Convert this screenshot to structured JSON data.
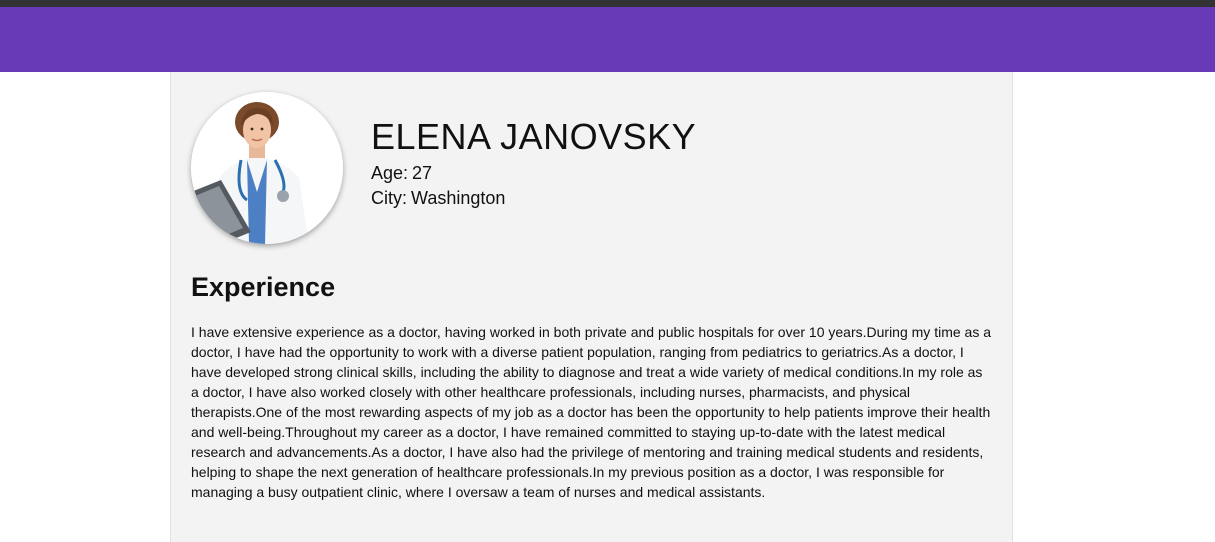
{
  "profile": {
    "name": "ELENA JANOVSKY",
    "age_label": "Age:",
    "age": "27",
    "city_label": "City:",
    "city": "Washington",
    "avatar_icon": "doctor-portrait"
  },
  "experience": {
    "title": "Experience",
    "text": "I have extensive experience as a doctor, having worked in both private and public hospitals for over 10 years.During my time as a doctor, I have had the opportunity to work with a diverse patient population, ranging from pediatrics to geriatrics.As a doctor, I have developed strong clinical skills, including the ability to diagnose and treat a wide variety of medical conditions.In my role as a doctor, I have also worked closely with other healthcare professionals, including nurses, pharmacists, and physical therapists.One of the most rewarding aspects of my job as a doctor has been the opportunity to help patients improve their health and well-being.Throughout my career as a doctor, I have remained committed to staying up-to-date with the latest medical research and advancements.As a doctor, I have also had the privilege of mentoring and training medical students and residents, helping to shape the next generation of healthcare professionals.In my previous position as a doctor, I was responsible for managing a busy outpatient clinic, where I oversaw a team of nurses and medical assistants."
  },
  "colors": {
    "header": "#673ab7",
    "top_strip": "#333333",
    "card_background": "#f3f3f3"
  }
}
